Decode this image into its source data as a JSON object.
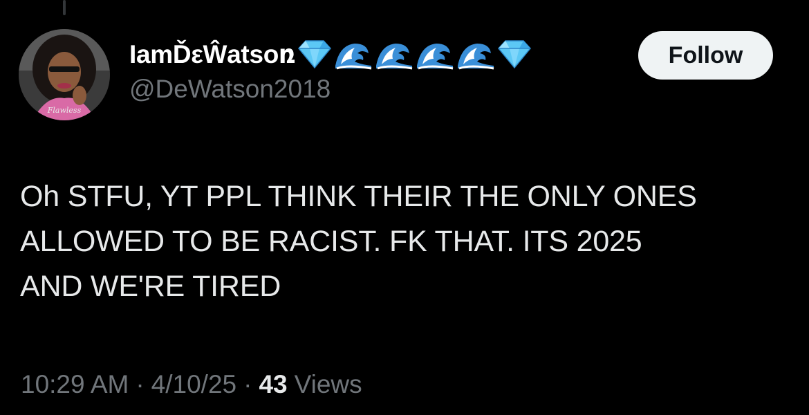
{
  "tweet": {
    "author": {
      "display_name": "IamĎεŴatsoռ",
      "handle": "@DeWatson2018",
      "name_emojis": [
        "gem-icon",
        "wave-icon",
        "wave-icon",
        "wave-icon",
        "wave-icon",
        "gem-icon"
      ],
      "avatar_caption": "Flawless"
    },
    "follow_label": "Follow",
    "text_lines": [
      "Oh STFU, YT PPL THINK THEIR THE ONLY ONES",
      "ALLOWED TO BE RACIST. FK THAT. ITS 2025",
      "AND WE'RE TIRED"
    ],
    "time": "10:29 AM",
    "date": "4/10/25",
    "separator": "·",
    "views_count": "43",
    "views_label": "Views"
  },
  "colors": {
    "background": "#000000",
    "primary_text": "#e7e9ea",
    "secondary_text": "#71767b",
    "follow_button_bg": "#eff3f4",
    "follow_button_text": "#0f1419",
    "gem": "#5cc8f5",
    "wave": "#3a8fd8"
  }
}
